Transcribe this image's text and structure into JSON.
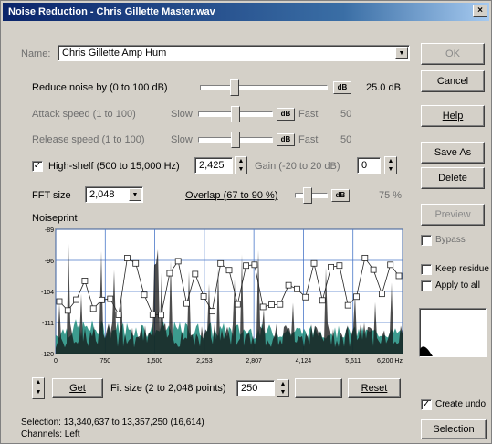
{
  "window": {
    "title": "Noise Reduction - Chris Gillette Master.wav",
    "close_glyph": "×"
  },
  "preset": {
    "label": "Name:",
    "value": "Chris Gillette Amp Hum"
  },
  "controls": {
    "reduce": {
      "label": "Reduce noise by (0 to 100 dB)",
      "value": "25.0 dB",
      "level": 0.25,
      "db_glyph": "dB"
    },
    "attack": {
      "label": "Attack speed (1 to 100)",
      "slow": "Slow",
      "fast": "Fast",
      "value": "50",
      "level": 0.5
    },
    "release": {
      "label": "Release speed (1 to 100)",
      "slow": "Slow",
      "fast": "Fast",
      "value": "50",
      "level": 0.5
    },
    "highshelf": {
      "check": "✓",
      "label": "High-shelf (500 to 15,000 Hz)",
      "value": "2,425",
      "gain_label": "Gain (-20 to 20 dB)",
      "gain_value": "0"
    },
    "fft": {
      "label": "FFT size",
      "value": "2,048"
    },
    "overlap": {
      "label": "Overlap (67 to 90 %)",
      "value": "75 %",
      "level": 0.33
    }
  },
  "noiseprint": {
    "label": "Noiseprint",
    "y_ticks": [
      "-89",
      "-96",
      "-104",
      "-111",
      "-120"
    ],
    "x_ticks": [
      "0",
      "750",
      "1,500",
      "2,253",
      "2,807",
      "4,124",
      "5,611",
      "6,200 Hz"
    ]
  },
  "bottom": {
    "get_label": "Get",
    "fit_label": "Fit size (2 to 2,048 points)",
    "fit_value": "250",
    "btn2_label": "",
    "reset_label": "Reset"
  },
  "sidebar": {
    "ok": "OK",
    "cancel": "Cancel",
    "help": "Help",
    "save_as": "Save As",
    "delete": "Delete",
    "preview": "Preview",
    "bypass": "Bypass",
    "keep_residue": "Keep residue",
    "apply_all": "Apply to all",
    "create_undo": "Create undo",
    "selection_btn": "Selection"
  },
  "status": {
    "selection": "Selection:   13,340,637 to 13,357,250 (16,614)",
    "channels": "Channels:   Left"
  }
}
